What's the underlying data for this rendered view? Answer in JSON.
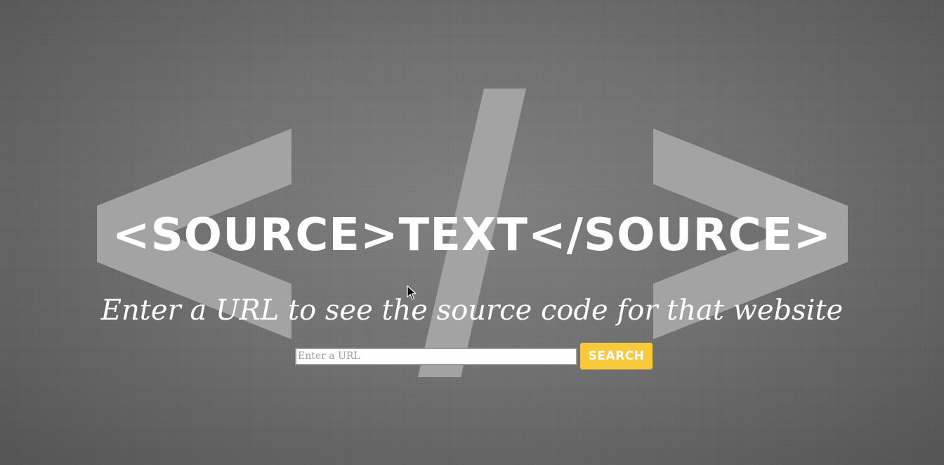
{
  "hero": {
    "title": "<SOURCE>TEXT</SOURCE>",
    "tagline": "Enter a URL to see the source code for that website"
  },
  "search": {
    "placeholder": "Enter a URL",
    "value": "",
    "button_label": "SEARCH"
  },
  "icons": {
    "background": "code-brackets-icon",
    "cursor": "mouse-cursor-icon"
  },
  "colors": {
    "background": "#6f6f6f",
    "glyph": "#a3a3a3",
    "text": "#ffffff",
    "accent": "#f8c93a"
  }
}
